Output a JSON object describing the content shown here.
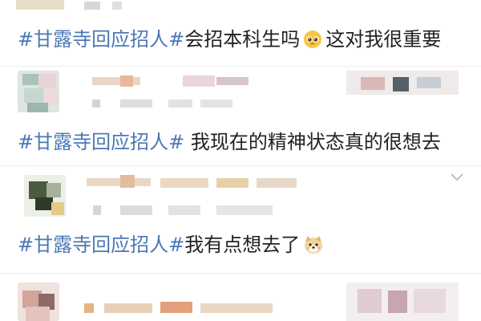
{
  "posts": [
    {
      "hashtag": "#甘露寺回应招人#",
      "text": "会招本科生吗",
      "emoji": "pleading-face-emoji",
      "text_after": "这对我很重要"
    },
    {
      "hashtag": "#甘露寺回应招人#",
      "text": " 我现在的精神状态真的很想去"
    },
    {
      "hashtag": "#甘露寺回应招人#",
      "text": "我有点想去了",
      "emoji": "dog-face-emoji"
    }
  ],
  "icons": {
    "expand": "chevron-down-icon"
  },
  "colors": {
    "hashtag": "#4b77b6",
    "text": "#222222",
    "divider": "#ececec"
  }
}
